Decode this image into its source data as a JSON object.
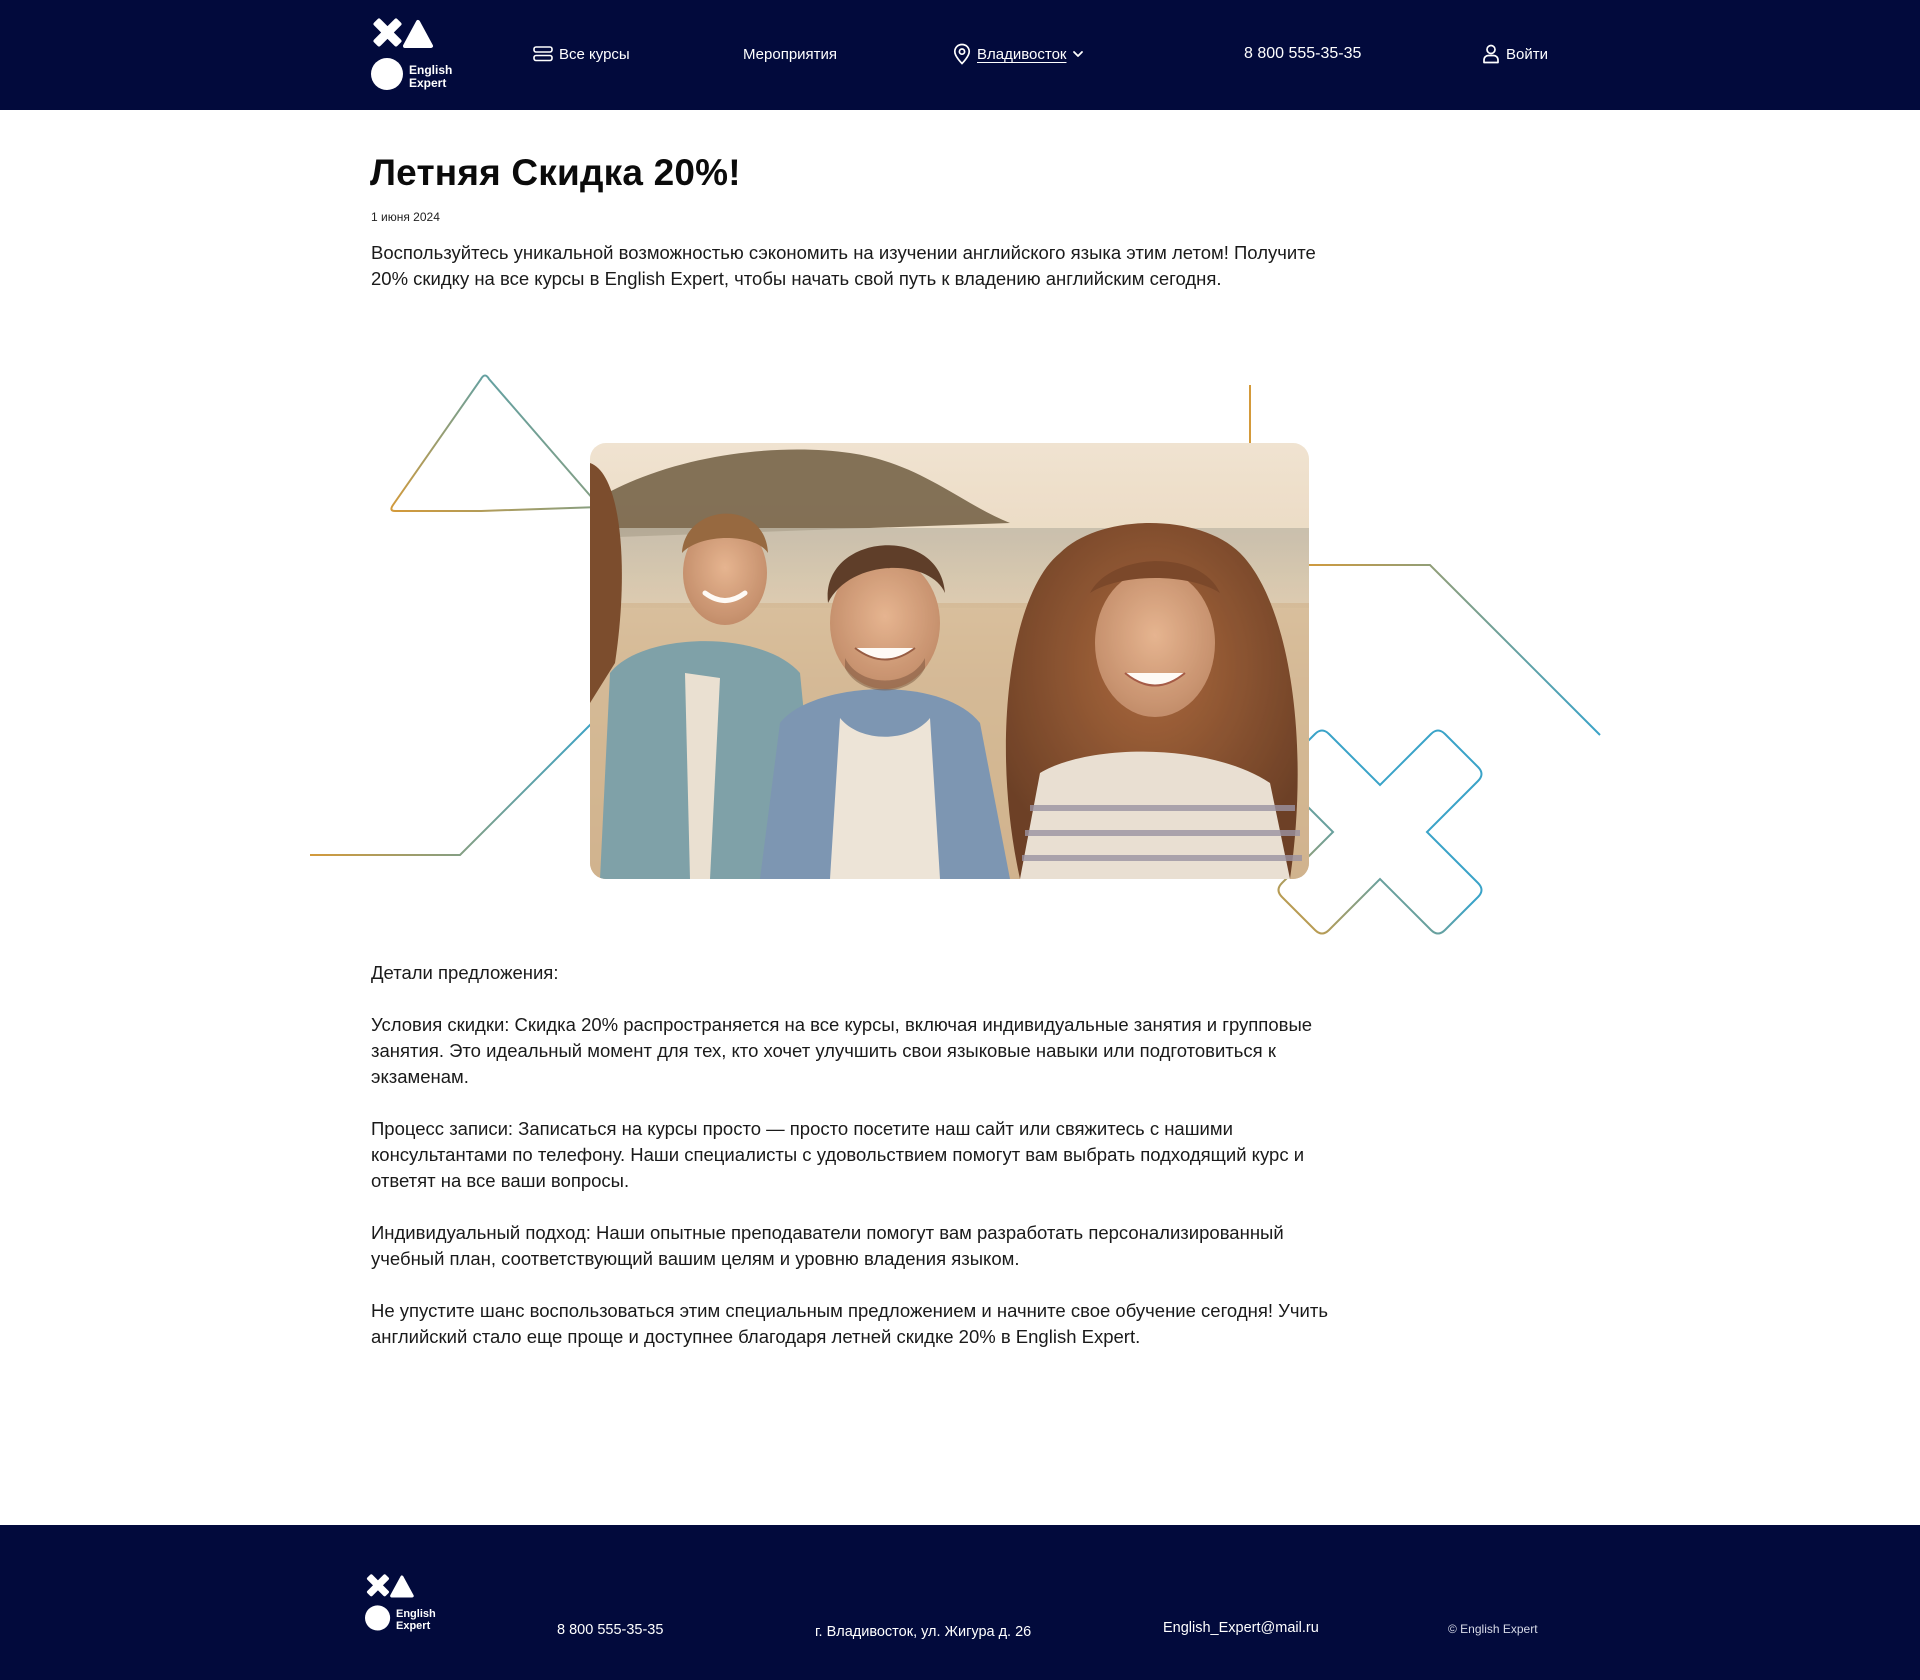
{
  "header": {
    "logo_text_line1": "English",
    "logo_text_line2": "Expert",
    "nav": {
      "courses_label": "Все курсы",
      "events_label": "Мероприятия",
      "city_label": "Владивосток",
      "phone": "8 800 555-35-35",
      "login_label": "Войти"
    },
    "icons": {
      "courses": "menu-list-icon",
      "city": "location-pin-icon",
      "city_dropdown": "chevron-down-icon",
      "login": "user-icon"
    }
  },
  "article": {
    "title": "Летняя Скидка 20%!",
    "date": "1 июня 2024",
    "intro": "Воспользуйтесь уникальной возможностью сэкономить на изучении английского языка этим летом! Получите 20% скидку на все курсы в English Expert, чтобы начать свой путь к владению английским сегодня.",
    "details_heading": "Детали предложения:",
    "conditions": "Условия скидки: Скидка 20% распространяется на все курсы, включая индивидуальные занятия и групповые занятия. Это идеальный момент для тех, кто хочет улучшить свои языковые навыки или подготовиться к экзаменам.",
    "process": "Процесс записи: Записаться на курсы просто — просто посетите наш сайт или свяжитесь с нашими консультантами по телефону. Наши специалисты с удовольствием помогут вам выбрать подходящий курс и ответят на все ваши вопросы.",
    "individual": "Индивидуальный подход: Наши опытные преподаватели помогут вам разработать персонализированный учебный план, соответствующий вашим целям и уровню владения языком.",
    "outro": "Не упустите шанс воспользоваться этим специальным предложением и начните свое обучение сегодня! Учить английский стало еще проще и доступнее благодаря летней скидке 20% в English Expert."
  },
  "footer": {
    "logo_text_line1": "English",
    "logo_text_line2": "Expert",
    "phone": "8 800 555-35-35",
    "address": "г. Владивосток, ул. Жигура д. 26",
    "email": "English_Expert@mail.ru",
    "copyright": "© English Expert"
  },
  "colors": {
    "brand_navy": "#020a3c",
    "accent_orange": "#d49a3a",
    "accent_blue": "#3aa3c8"
  }
}
